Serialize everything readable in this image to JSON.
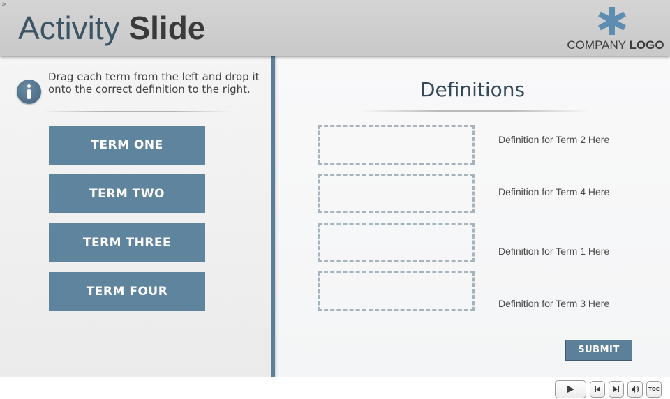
{
  "header": {
    "menu_toggle_icon": "double-chevron-right-icon",
    "menu_toggle_glyph": "»",
    "title_light": "Activity",
    "title_bold": "Slide",
    "logo": {
      "icon": "asterisk-icon",
      "text_regular": "COMPANY",
      "text_bold": "LOGO",
      "color": "#5d8db0"
    }
  },
  "instructions": {
    "icon": "info-icon",
    "text": "Drag each term from the left and drop it onto the correct definition to the right."
  },
  "terms": [
    {
      "label": "TERM ONE"
    },
    {
      "label": "TERM TWO"
    },
    {
      "label": "TERM THREE"
    },
    {
      "label": "TERM FOUR"
    }
  ],
  "definitions": {
    "title": "Definitions",
    "items": [
      {
        "text": "Definition for Term 2 Here"
      },
      {
        "text": "Definition for Term 4 Here"
      },
      {
        "text": "Definition for Term 1 Here"
      },
      {
        "text": "Definition for Term 3 Here"
      }
    ]
  },
  "submit_label": "SUBMIT",
  "playbar": {
    "play_icon": "play-icon",
    "prev_icon": "previous-slide-icon",
    "next_icon": "next-slide-icon",
    "audio_icon": "volume-icon",
    "toc_label": "TOC"
  },
  "colors": {
    "accent": "#5f849d",
    "title_dark": "#3c5565",
    "dropzone_border": "#a6b4bd"
  }
}
